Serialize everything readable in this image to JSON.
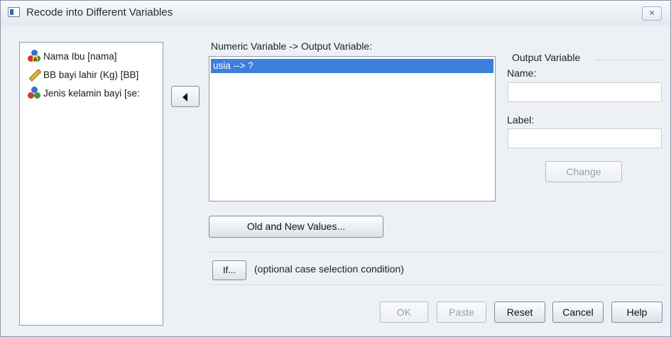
{
  "dialog": {
    "title": "Recode into Different Variables",
    "close_label": "✕"
  },
  "source_variables": [
    {
      "label": "Nama Ibu [nama]",
      "icon": "nominal-string-icon"
    },
    {
      "label": "BB bayi lahir (Kg) [BB]",
      "icon": "scale-ruler-icon"
    },
    {
      "label": "Jenis kelamin bayi [se:",
      "icon": "nominal-icon"
    }
  ],
  "mapping": {
    "header": "Numeric Variable -> Output Variable:",
    "items": [
      "usia --> ?"
    ]
  },
  "output_variable": {
    "group_title": "Output Variable",
    "name_label": "Name:",
    "name_value": "",
    "label_label": "Label:",
    "label_value": "",
    "change_label": "Change"
  },
  "old_new_values_label": "Old and New Values...",
  "if_button": {
    "label": "If...",
    "description": "(optional case selection condition)"
  },
  "footer": {
    "ok": "OK",
    "paste": "Paste",
    "reset": "Reset",
    "cancel": "Cancel",
    "help": "Help"
  }
}
